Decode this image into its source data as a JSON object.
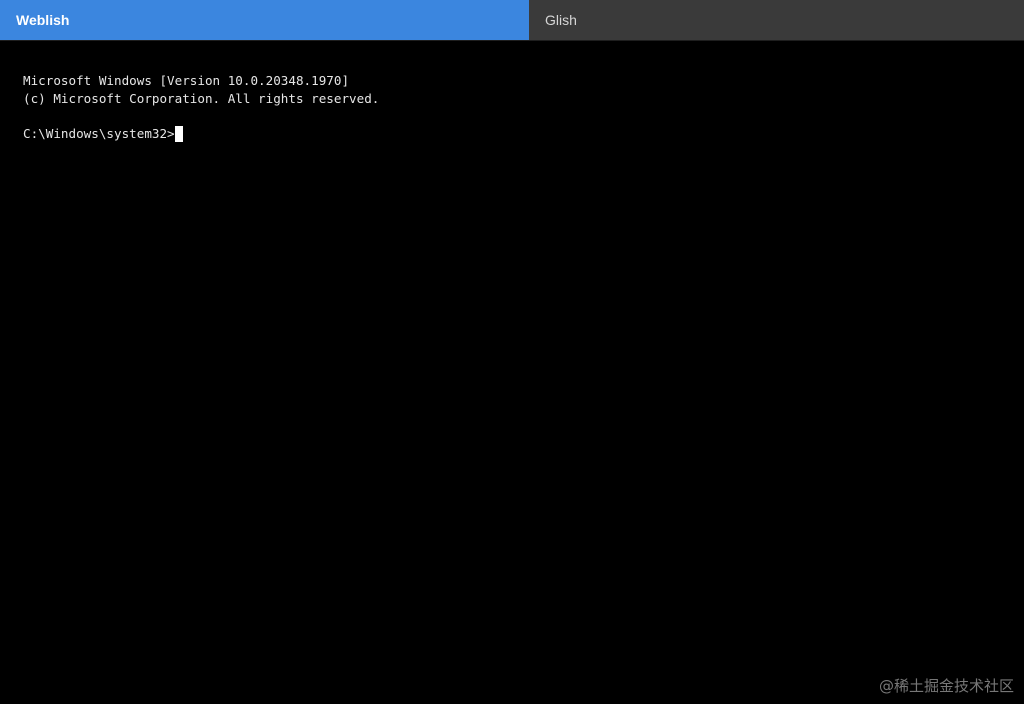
{
  "tabs": [
    {
      "label": "Weblish",
      "active": true
    },
    {
      "label": "Glish",
      "active": false
    }
  ],
  "terminal": {
    "lines": [
      "Microsoft Windows [Version 10.0.20348.1970]",
      "(c) Microsoft Corporation. All rights reserved."
    ],
    "prompt": "C:\\Windows\\system32>"
  },
  "watermark": "@稀土掘金技术社区",
  "colors": {
    "active_tab": "#3b86df",
    "inactive_tab": "#3a3a3a",
    "terminal_bg": "#000000",
    "terminal_text": "#e6e6e6"
  }
}
